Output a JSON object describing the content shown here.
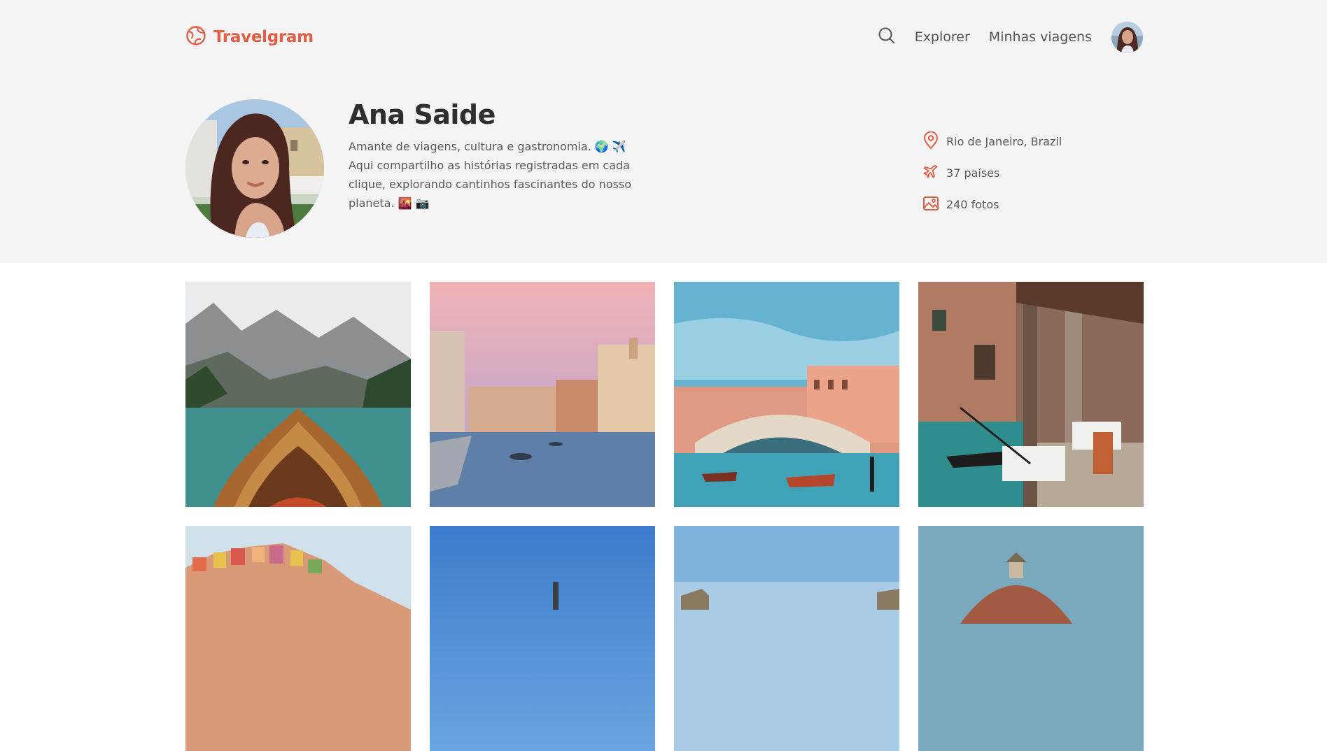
{
  "colors": {
    "accent": "#e25f47",
    "header_bg": "#f4f4f4"
  },
  "nav": {
    "brand": "Travelgram",
    "logo_icon": "globe-icon",
    "links": [
      "Explorer",
      "Minhas viagens"
    ],
    "search_icon": "search-icon"
  },
  "profile": {
    "name": "Ana Saide",
    "bio": "Amante de viagens, cultura e gastronomia. 🌍 ✈️ Aqui compartilho as histórias registradas em cada clique, explorando cantinhos fascinantes do nosso planeta. 🌇 📷",
    "location": "Rio de Janeiro, Brazil",
    "countries": "37 países",
    "photos": "240 fotos"
  },
  "gallery": {
    "photos": [
      "Mountain lake boat",
      "Venice canal at sunset",
      "Rialto Bridge",
      "Venetian canal café",
      "Cinque Terre houses",
      "Blue sky",
      "Coastal town",
      "Cathedral dome"
    ]
  }
}
